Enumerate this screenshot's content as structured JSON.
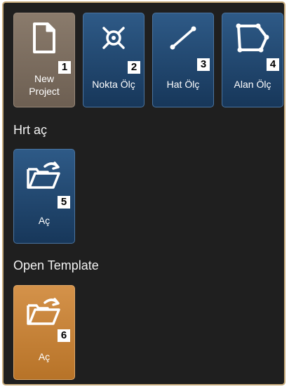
{
  "tiles": {
    "new_project": {
      "label_line1": "New",
      "label_line2": "Project",
      "number": "1"
    },
    "nokta_olc": {
      "label": "Nokta Ölç",
      "number": "2"
    },
    "hat_olc": {
      "label": "Hat Ölç",
      "number": "3"
    },
    "alan_olc": {
      "label": "Alan Ölç",
      "number": "4"
    }
  },
  "sections": {
    "hrt": {
      "title": "Hrt aç",
      "tile": {
        "label": "Aç",
        "number": "5"
      }
    },
    "template": {
      "title": "Open Template",
      "tile": {
        "label": "Aç",
        "number": "6"
      }
    }
  },
  "icons": {
    "new_project": "document-icon",
    "nokta_olc": "point-measure-icon",
    "hat_olc": "line-measure-icon",
    "alan_olc": "area-measure-icon",
    "open": "open-folder-icon"
  },
  "colors": {
    "background": "#1f1f1f",
    "border": "#c9ad7e",
    "blue_tile": "#1f4670",
    "gray_tile": "#7a6b5d",
    "orange_tile": "#c7823a"
  }
}
